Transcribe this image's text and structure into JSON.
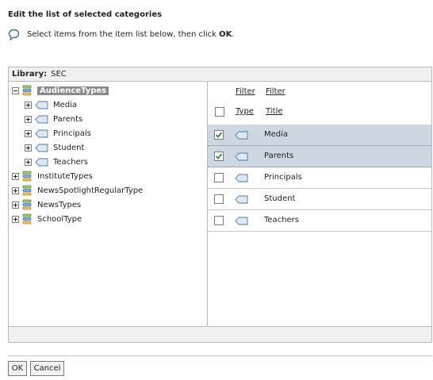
{
  "dialog": {
    "title": "Edit the list of selected categories",
    "instruction_prefix": "Select items from the item list below, then click",
    "instruction_bold": "OK",
    "instruction_suffix": "."
  },
  "library": {
    "label": "Library:",
    "value": "SEC"
  },
  "tree": {
    "root": "AudienceTypes",
    "children": [
      "Media",
      "Parents",
      "Principals",
      "Student",
      "Teachers"
    ],
    "siblings": [
      "InstituteTypes",
      "NewsSpotlightRegularType",
      "NewsTypes",
      "SchoolType"
    ]
  },
  "list": {
    "filter_type": "Filter",
    "filter_title": "Filter",
    "col_type": "Type",
    "col_title": "Title",
    "rows": [
      {
        "title": "Media",
        "checked": true
      },
      {
        "title": "Parents",
        "checked": true
      },
      {
        "title": "Principals",
        "checked": false
      },
      {
        "title": "Student",
        "checked": false
      },
      {
        "title": "Teachers",
        "checked": false
      }
    ]
  },
  "buttons": {
    "ok": "OK",
    "cancel": "Cancel"
  },
  "colors": {
    "selected_row": "#cdd7e1",
    "check": "#2f8f2f",
    "tag": "#dde8f2"
  }
}
